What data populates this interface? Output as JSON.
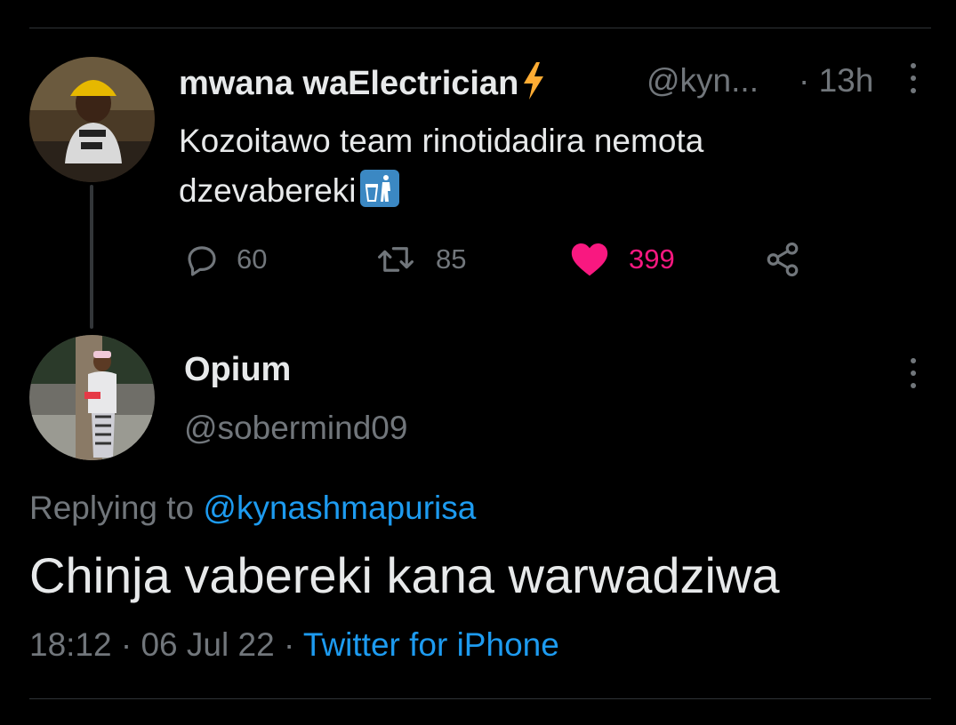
{
  "tweet": {
    "author_name": "mwana waElectrician",
    "name_emoji": "high-voltage-emoji",
    "handle": "@kyn...",
    "separator": "·",
    "time_ago": "13h",
    "text": "Kozoitawo team rinotidadira nemota dzevabereki",
    "text_emoji": "wastebasket-emoji",
    "replies": "60",
    "retweets": "85",
    "likes": "399",
    "liked": true
  },
  "reply": {
    "author_name": "Opium",
    "handle": "@sobermind09",
    "replying_prefix": "Replying to",
    "replying_handle": "@kynashmapurisa",
    "text": "Chinja vabereki kana warwadziwa",
    "time": "18:12",
    "separator": "·",
    "date": "06 Jul 22",
    "source": "Twitter for iPhone"
  },
  "colors": {
    "background": "#000000",
    "primary_text": "#e7e9ea",
    "secondary_text": "#71767b",
    "link": "#1d9bf0",
    "like": "#f91880",
    "divider": "#2f3336"
  },
  "icons": {
    "reply": "speech-bubble-icon",
    "retweet": "retweet-icon",
    "like": "heart-icon",
    "share": "share-icon",
    "more": "more-vertical-icon"
  }
}
